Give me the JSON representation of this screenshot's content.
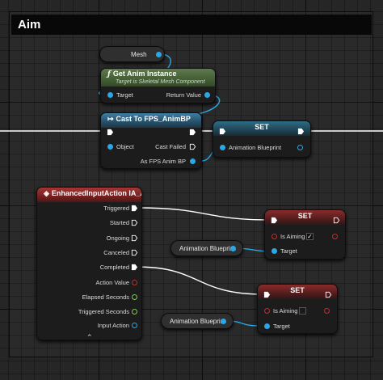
{
  "comment": {
    "title": "Aim"
  },
  "mesh_node": {
    "label": "Mesh"
  },
  "get_anim_instance": {
    "title": "Get Anim Instance",
    "subtitle": "Target is Skeletal Mesh Component",
    "target_pin": "Target",
    "return_pin": "Return Value"
  },
  "cast_node": {
    "title": "Cast To FPS_AnimBP",
    "object_pin": "Object",
    "cast_failed_pin": "Cast Failed",
    "as_pin": "As FPS Anim BP"
  },
  "set_top": {
    "title": "SET",
    "pin": "Animation Blueprint"
  },
  "input_action": {
    "title": "EnhancedInputAction IA_Aim",
    "pins": [
      "Triggered",
      "Started",
      "Ongoing",
      "Canceled",
      "Completed",
      "Action Value",
      "Elapsed Seconds",
      "Triggered Seconds",
      "Input Action"
    ],
    "expand_glyph": "⌃"
  },
  "set_aim_true": {
    "title": "SET",
    "is_aiming_label": "Is Aiming",
    "is_aiming_value": true,
    "target_label": "Target",
    "check_glyph": "✓"
  },
  "anim_bp_getter_1": {
    "label": "Animation Blueprint"
  },
  "set_aim_false": {
    "title": "SET",
    "is_aiming_label": "Is Aiming",
    "is_aiming_value": false,
    "target_label": "Target"
  },
  "anim_bp_getter_2": {
    "label": "Animation Blueprint"
  },
  "colors": {
    "exec": "#ffffff",
    "object": "#28a8e8",
    "bool": "#cc2a2a",
    "float": "#7ad04a"
  }
}
